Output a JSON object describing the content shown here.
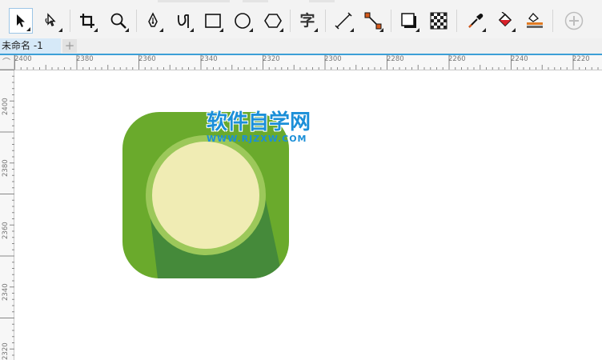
{
  "toolbar": {
    "tools": [
      {
        "name": "pick-tool",
        "icon": "arrow-pointer-icon",
        "active": true
      },
      {
        "name": "shape-tool",
        "icon": "shape-node-icon"
      },
      {
        "name": "crop-tool",
        "icon": "crop-icon"
      },
      {
        "name": "zoom-tool",
        "icon": "magnifier-icon"
      },
      {
        "name": "pen-tool",
        "icon": "pen-nib-icon"
      },
      {
        "name": "artistic-media-tool",
        "icon": "artistic-curve-icon"
      },
      {
        "name": "rectangle-tool",
        "icon": "rectangle-icon"
      },
      {
        "name": "ellipse-tool",
        "icon": "ellipse-icon"
      },
      {
        "name": "polygon-tool",
        "icon": "hexagon-icon"
      },
      {
        "name": "text-tool",
        "icon": "text-char-icon",
        "glyph": "字"
      },
      {
        "name": "dimension-tool",
        "icon": "dimension-line-icon"
      },
      {
        "name": "connector-tool",
        "icon": "connector-icon"
      },
      {
        "name": "drop-shadow-tool",
        "icon": "drop-shadow-icon"
      },
      {
        "name": "transparency-tool",
        "icon": "checkerboard-icon"
      },
      {
        "name": "eyedropper-tool",
        "icon": "eyedropper-icon"
      },
      {
        "name": "interactive-fill-tool",
        "icon": "paint-bucket-icon"
      },
      {
        "name": "smart-fill-tool",
        "icon": "smart-fill-icon"
      },
      {
        "name": "add-tool",
        "icon": "plus-circle-icon"
      }
    ]
  },
  "tabs": {
    "document_tab": "未命名 -1",
    "add_tab": "+"
  },
  "ruler": {
    "horizontal": [
      "2400",
      "2380",
      "2360",
      "2340",
      "2320",
      "2300",
      "2280",
      "2260",
      "2240",
      "2220"
    ],
    "vertical": [
      "2400",
      "2380",
      "2360",
      "2340",
      "2320"
    ],
    "corner_glyph": "⌒"
  },
  "watermark": {
    "title": "软件自学网",
    "subtitle": "WWW.RJZXW.COM"
  },
  "colors": {
    "icon_green": "#6aaa2c",
    "icon_dark_green": "#458a3a",
    "ring_green": "#9cc85a",
    "circle_cream": "#f0ecb4",
    "watermark_blue": "#1b8fd8",
    "tab_underline": "#3c9fd7"
  }
}
